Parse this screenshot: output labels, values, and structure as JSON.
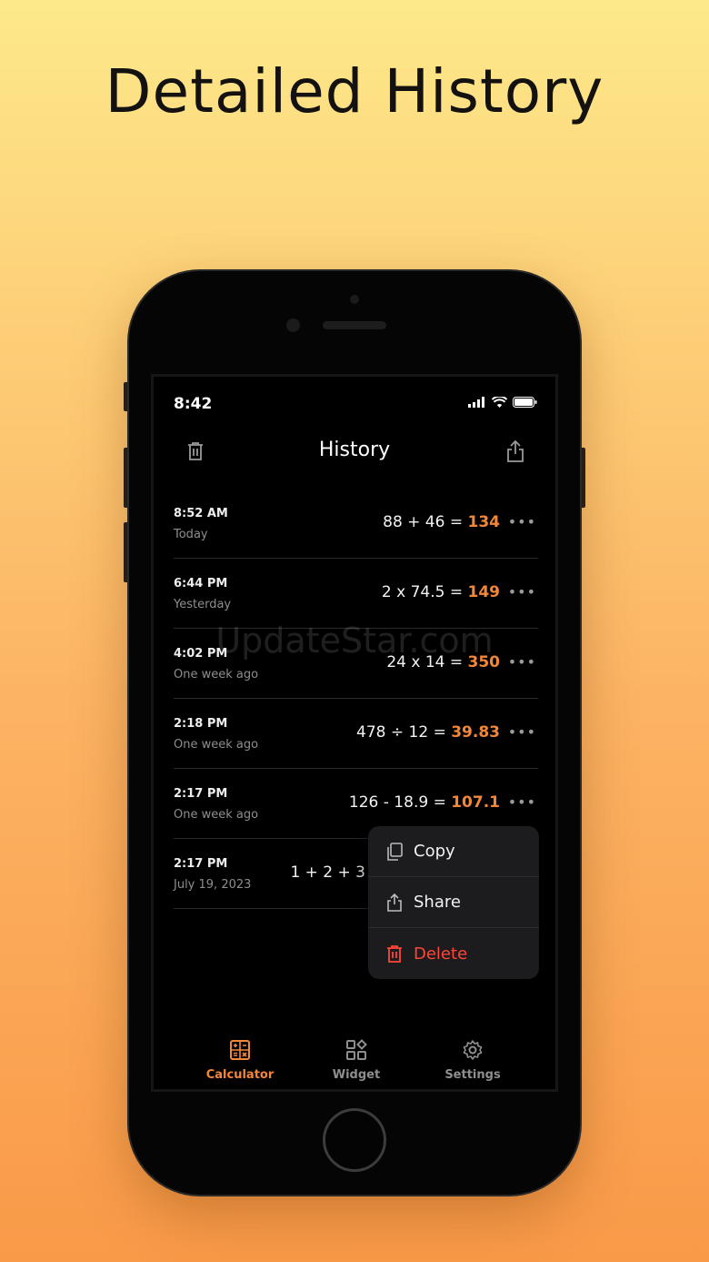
{
  "headline": "Detailed History",
  "status": {
    "time": "8:42"
  },
  "header": {
    "title": "History",
    "trash_icon": "trash-icon",
    "share_icon": "share-icon"
  },
  "rows": [
    {
      "time": "8:52 AM",
      "date": "Today",
      "expression": "88 + 46 = ",
      "result": "134"
    },
    {
      "time": "6:44 PM",
      "date": "Yesterday",
      "expression": "2 x 74.5 = ",
      "result": "149"
    },
    {
      "time": "4:02 PM",
      "date": "One week ago",
      "expression": "24 x 14 = ",
      "result": "350"
    },
    {
      "time": "2:18 PM",
      "date": "One week ago",
      "expression": "478 ÷ 12 = ",
      "result": "39.83"
    },
    {
      "time": "2:17 PM",
      "date": "One week ago",
      "expression": "126 - 18.9 = ",
      "result": "107.1"
    },
    {
      "time": "2:17 PM",
      "date": "July 19, 2023",
      "expression": "1 + 2 + 3",
      "result": ""
    }
  ],
  "more_glyph": "•••",
  "context_menu": {
    "copy": "Copy",
    "share": "Share",
    "delete": "Delete"
  },
  "tabs": [
    {
      "label": "Calculator",
      "icon": "calculator-icon"
    },
    {
      "label": "Widget",
      "icon": "widget-icon"
    },
    {
      "label": "Settings",
      "icon": "gear-icon"
    }
  ],
  "watermark": "UpdateStar.com",
  "colors": {
    "accent": "#f2873a",
    "danger": "#ff4538",
    "background": "#000000"
  }
}
